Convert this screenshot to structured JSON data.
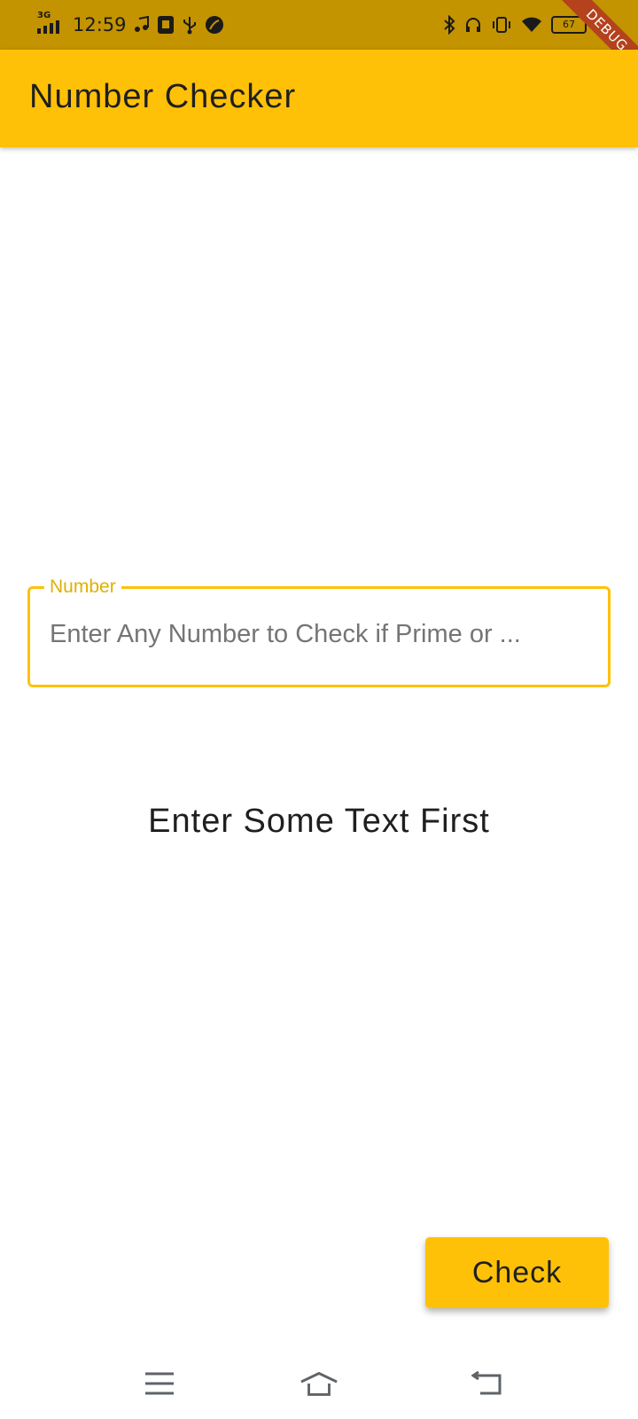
{
  "status_bar": {
    "time": "12:59",
    "network": "3G",
    "battery": "67"
  },
  "debug_banner": "DEBUG",
  "app_bar": {
    "title": "Number Checker"
  },
  "number_field": {
    "label": "Number",
    "placeholder": "Enter Any Number to Check if Prime or ...",
    "value": ""
  },
  "result": {
    "text": "Enter Some Text First"
  },
  "check_button": {
    "label": "Check"
  },
  "colors": {
    "status_bar": "#C39300",
    "app_bar": "#FFC107",
    "accent": "#FFC107",
    "debug_ribbon": "#B4421D"
  },
  "icons": {
    "status_left": [
      "signal-icon",
      "music-icon",
      "usb-debug-icon",
      "usb-icon",
      "leaf-icon"
    ],
    "status_right": [
      "bluetooth-icon",
      "headphones-icon",
      "vibrate-icon",
      "wifi-icon",
      "battery-icon",
      "charging-icon"
    ],
    "nav": [
      "menu-icon",
      "home-icon",
      "back-icon"
    ]
  }
}
